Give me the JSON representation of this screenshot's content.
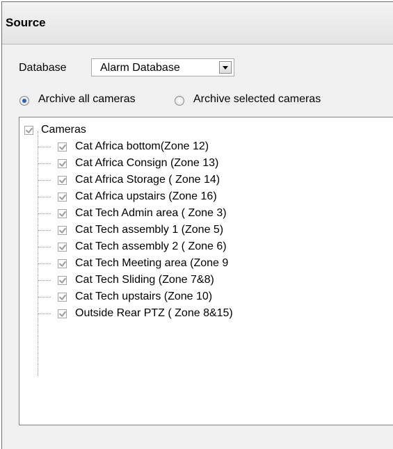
{
  "section": {
    "title": "Source"
  },
  "database": {
    "label": "Database",
    "selected": "Alarm Database"
  },
  "archive_options": [
    {
      "label": "Archive all cameras",
      "checked": true
    },
    {
      "label": "Archive selected cameras",
      "checked": false
    }
  ],
  "tree": {
    "root": {
      "label": "Cameras",
      "checked": true
    },
    "items": [
      {
        "label": "Cat Africa bottom(Zone 12)",
        "checked": true
      },
      {
        "label": "Cat Africa Consign (Zone 13)",
        "checked": true
      },
      {
        "label": "Cat Africa Storage ( Zone 14)",
        "checked": true
      },
      {
        "label": "Cat Africa upstairs (Zone 16)",
        "checked": true
      },
      {
        "label": "Cat Tech Admin area ( Zone 3)",
        "checked": true
      },
      {
        "label": "Cat Tech assembly 1 (Zone 5)",
        "checked": true
      },
      {
        "label": "Cat Tech assembly 2 ( Zone 6)",
        "checked": true
      },
      {
        "label": "Cat Tech Meeting area (Zone 9",
        "checked": true
      },
      {
        "label": "Cat Tech Sliding (Zone 7&8)",
        "checked": true
      },
      {
        "label": "Cat Tech upstairs  (Zone 10)",
        "checked": true
      },
      {
        "label": "Outside Rear PTZ ( Zone 8&15)",
        "checked": true
      }
    ]
  }
}
